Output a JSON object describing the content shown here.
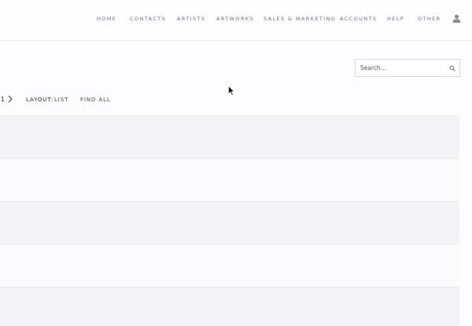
{
  "nav": {
    "items": [
      {
        "label": "HOME"
      },
      {
        "label": "CONTACTS"
      },
      {
        "label": "ARTISTS"
      },
      {
        "label": "ARTWORKS"
      },
      {
        "label": "SALES & MARKETING"
      },
      {
        "label": "ACCOUNTS"
      },
      {
        "label": "HELP"
      },
      {
        "label": "OTHER"
      }
    ],
    "user_icon": "user-icon"
  },
  "search": {
    "placeholder": "Search...",
    "value": "",
    "icon": "search-icon"
  },
  "toolbar": {
    "page_number": "1",
    "next_icon": "chevron-right-icon",
    "layout_label": "LAYOUT:",
    "layout_value": "LIST",
    "find_all_label": "FIND ALL"
  },
  "list": {
    "row_count": 5
  },
  "colors": {
    "background": "#fdfcfe",
    "row_alt": "#f4f4f7",
    "row_plain": "#fbfbfd",
    "divider": "#e9e9ec",
    "nav_text": "#6e6e72"
  }
}
